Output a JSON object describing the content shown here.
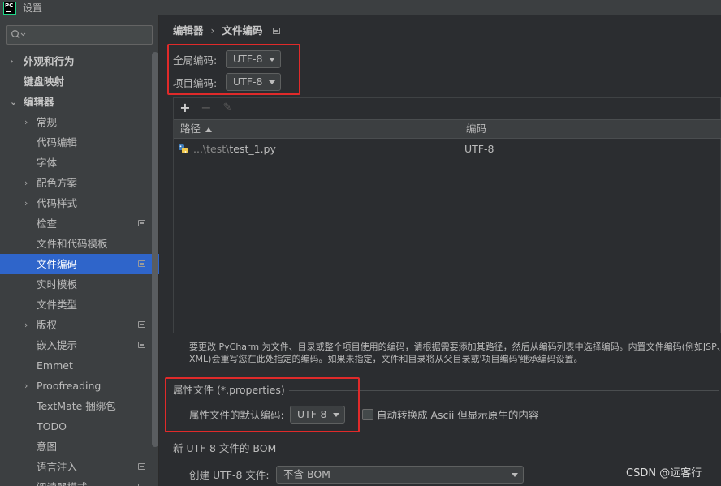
{
  "window": {
    "title": "设置",
    "logo_text": "PC"
  },
  "sidebar": {
    "search_placeholder": "",
    "items": [
      {
        "label": "外观和行为",
        "arrow": "›",
        "bold": true,
        "level": 0
      },
      {
        "label": "键盘映射",
        "arrow": "",
        "bold": true,
        "level": 0
      },
      {
        "label": "编辑器",
        "arrow": "⌄",
        "bold": true,
        "level": 0
      },
      {
        "label": "常规",
        "arrow": "›",
        "level": 1
      },
      {
        "label": "代码编辑",
        "arrow": "",
        "level": 1
      },
      {
        "label": "字体",
        "arrow": "",
        "level": 1
      },
      {
        "label": "配色方案",
        "arrow": "›",
        "level": 1
      },
      {
        "label": "代码样式",
        "arrow": "›",
        "level": 1
      },
      {
        "label": "检查",
        "arrow": "",
        "level": 1,
        "badge": true
      },
      {
        "label": "文件和代码模板",
        "arrow": "",
        "level": 1
      },
      {
        "label": "文件编码",
        "arrow": "",
        "level": 1,
        "badge": true,
        "selected": true
      },
      {
        "label": "实时模板",
        "arrow": "",
        "level": 1
      },
      {
        "label": "文件类型",
        "arrow": "",
        "level": 1
      },
      {
        "label": "版权",
        "arrow": "›",
        "level": 1,
        "badge": true
      },
      {
        "label": "嵌入提示",
        "arrow": "",
        "level": 1,
        "badge": true
      },
      {
        "label": "Emmet",
        "arrow": "",
        "level": 1
      },
      {
        "label": "Proofreading",
        "arrow": "›",
        "level": 1
      },
      {
        "label": "TextMate 捆绑包",
        "arrow": "",
        "level": 1
      },
      {
        "label": "TODO",
        "arrow": "",
        "level": 1
      },
      {
        "label": "意图",
        "arrow": "",
        "level": 1
      },
      {
        "label": "语言注入",
        "arrow": "",
        "level": 1,
        "badge": true
      },
      {
        "label": "阅读器模式",
        "arrow": "",
        "level": 1,
        "badge": true
      }
    ]
  },
  "breadcrumb": {
    "parent": "编辑器",
    "separator": "›",
    "current": "文件编码"
  },
  "global_encoding": {
    "label": "全局编码:",
    "value": "UTF-8"
  },
  "project_encoding": {
    "label": "项目编码:",
    "value": "UTF-8"
  },
  "table": {
    "toolbar": {
      "add": "+",
      "remove": "−",
      "edit": "✎"
    },
    "columns": [
      "路径",
      "编码"
    ],
    "rows": [
      {
        "path_prefix": "...\\test\\",
        "path_name": "test_1.py",
        "encoding": "UTF-8"
      }
    ]
  },
  "info": {
    "line1": "要更改 PyCharm 为文件、目录或整个项目使用的编码，请根据需要添加其路径，然后从编码列表中选择编码。内置文件编码(例如JSP、",
    "line2": "XML)会重写您在此处指定的编码。如果未指定，文件和目录将从父目录或'项目编码'继承编码设置。"
  },
  "properties": {
    "section_title": "属性文件 (*.properties)",
    "default_label": "属性文件的默认编码:",
    "default_value": "UTF-8",
    "checkbox_label": "自动转换成 Ascii 但显示原生的内容"
  },
  "bom": {
    "section_title": "新 UTF-8 文件的 BOM",
    "create_label": "创建 UTF-8 文件:",
    "create_value": "不含 BOM"
  },
  "watermark": "CSDN @远客行",
  "colors": {
    "accent": "#2f65ca",
    "highlight_box": "#e02a2a",
    "background": "#2b2d30",
    "sidebar": "#3c3f41"
  }
}
